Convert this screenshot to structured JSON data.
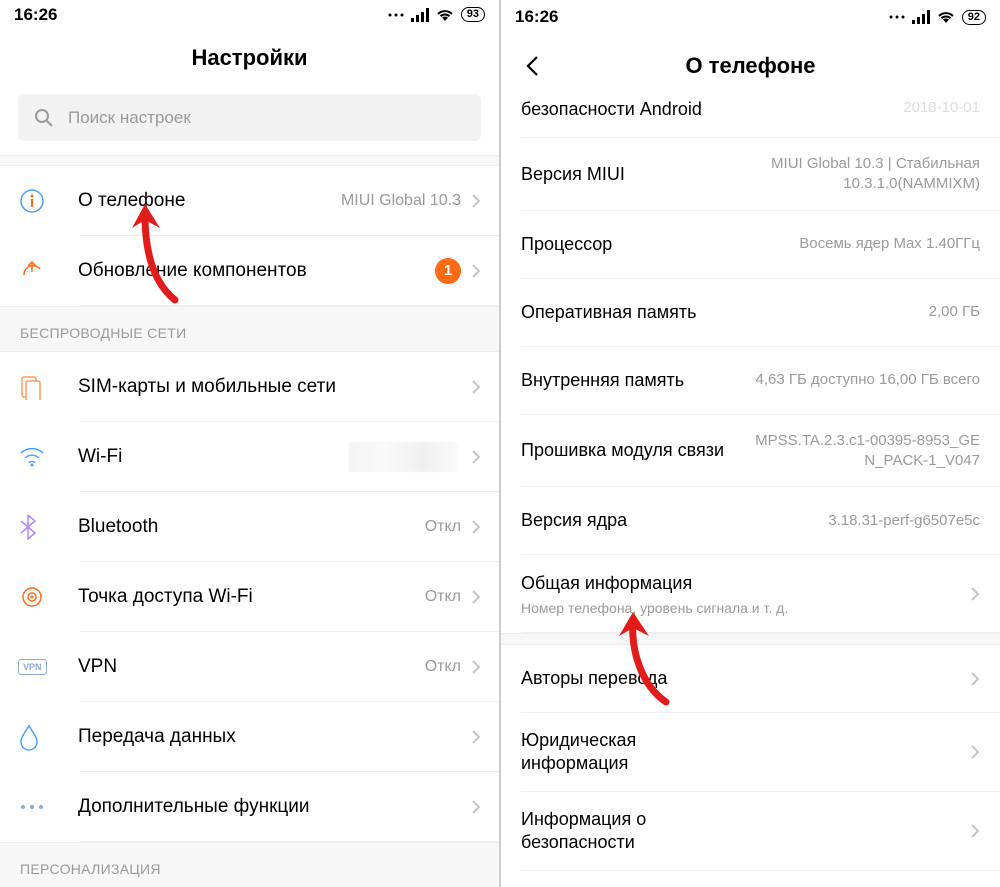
{
  "left": {
    "status": {
      "time": "16:26",
      "battery": "93"
    },
    "title": "Настройки",
    "search_placeholder": "Поиск настроек",
    "top": [
      {
        "label": "О телефоне",
        "value": "MIUI Global 10.3"
      },
      {
        "label": "Обновление компонентов",
        "badge": "1"
      }
    ],
    "sections": [
      {
        "header": "БЕСПРОВОДНЫЕ СЕТИ",
        "items": [
          {
            "label": "SIM-карты и мобильные сети",
            "value": ""
          },
          {
            "label": "Wi-Fi",
            "value": "",
            "blurred": true
          },
          {
            "label": "Bluetooth",
            "value": "Откл"
          },
          {
            "label": "Точка доступа Wi-Fi",
            "value": "Откл"
          },
          {
            "label": "VPN",
            "value": "Откл"
          },
          {
            "label": "Передача данных",
            "value": ""
          },
          {
            "label": "Дополнительные функции",
            "value": ""
          }
        ]
      },
      {
        "header": "ПЕРСОНАЛИЗАЦИЯ",
        "items": []
      }
    ]
  },
  "right": {
    "status": {
      "time": "16:26",
      "battery": "92"
    },
    "title": "О телефоне",
    "info": [
      {
        "label_cut": "безопасности Android",
        "value_cut": "2018-10-01"
      },
      {
        "label": "Версия MIUI",
        "value": "MIUI Global 10.3 | Стабильная 10.3.1.0(NAMMIXM)"
      },
      {
        "label": "Процессор",
        "value": "Восемь ядер Max 1.40ГГц"
      },
      {
        "label": "Оперативная память",
        "value": "2,00 ГБ"
      },
      {
        "label": "Внутренняя память",
        "value": "4,63 ГБ доступно 16,00 ГБ всего"
      },
      {
        "label": "Прошивка модуля связи",
        "value": "MPSS.TA.2.3.c1-00395-8953_GEN_PACK-1_V047"
      },
      {
        "label": "Версия ядра",
        "value": "3.18.31-perf-g6507e5c"
      }
    ],
    "nav": [
      {
        "label": "Общая информация",
        "sub": "Номер телефона, уровень сигнала и т. д."
      },
      {
        "label": "Авторы перевода"
      },
      {
        "label": "Юридическая информация"
      },
      {
        "label": "Информация о безопасности"
      }
    ]
  },
  "colors": {
    "accent": "#ff6a13"
  }
}
